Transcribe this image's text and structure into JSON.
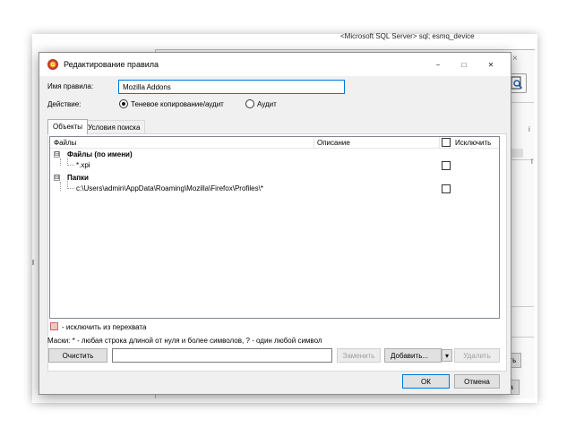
{
  "background_window": {
    "title": "<Microsoft SQL Server> sql; esmq_device",
    "close_glyph": "×",
    "cut_text_1": "i",
    "cut_text_2": "l",
    "button_fragment_1": "ить",
    "button_fragment_2": "на"
  },
  "dialog": {
    "title": "Редактирование правила",
    "minimize_glyph": "−",
    "maximize_glyph": "□",
    "close_glyph": "✕",
    "rule_name_label": "Имя правила:",
    "rule_name_value": "Mozilla Addons",
    "action_label": "Действие:",
    "action_options": [
      {
        "label": "Теневое копирование/аудит",
        "selected": true
      },
      {
        "label": "Аудит",
        "selected": false
      }
    ],
    "tabs": [
      {
        "label": "Объекты",
        "active": true
      },
      {
        "label": "Условия поиска",
        "active": false
      }
    ],
    "tree": {
      "col_files": "Файлы",
      "col_description": "Описание",
      "col_exclude": "Исключить",
      "groups": [
        {
          "label": "Файлы (по имени)",
          "expander": "⊟",
          "items": [
            {
              "value": "*.xpi",
              "excluded": false
            }
          ]
        },
        {
          "label": "Папки",
          "expander": "⊟",
          "items": [
            {
              "value": "c:\\Users\\admin\\AppData\\Roaming\\Mozilla\\Firefox\\Profiles\\*",
              "excluded": false
            }
          ]
        }
      ]
    },
    "legend_text": "- исключить из перехвата",
    "mask_text": "Маски: * - любая строка длиной от нуля и более символов, ? - один любой символ",
    "buttons": {
      "clear": "Очистить",
      "replace": "Заменить",
      "add": "Добавить...",
      "add_arrow": "▾",
      "delete": "Удалить",
      "ok": "ОК",
      "cancel": "Отмена"
    },
    "filter_value": ""
  },
  "colors": {
    "accent": "#0078d7",
    "exclude_swatch": "#f5c4c4",
    "dialog_bg": "#f0f0f0"
  }
}
